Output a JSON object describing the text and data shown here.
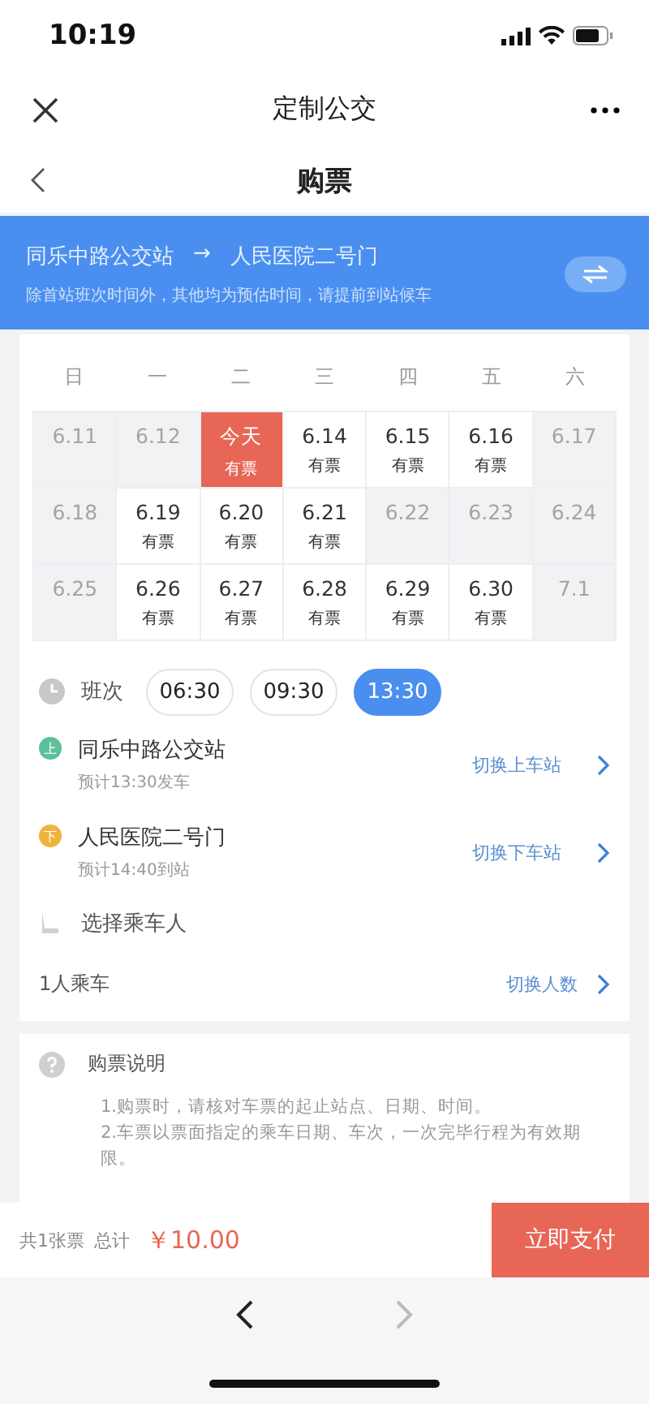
{
  "status_bar": {
    "time": "10:19"
  },
  "nav": {
    "title": "定制公交"
  },
  "header": {
    "title": "购票"
  },
  "route": {
    "from": "同乐中路公交站",
    "arrow": "→",
    "to": "人民医院二号门",
    "note": "除首站班次时间外，其他均为预估时间，请提前到站候车"
  },
  "calendar": {
    "weekdays": [
      "日",
      "一",
      "二",
      "三",
      "四",
      "五",
      "六"
    ],
    "weeks": [
      [
        {
          "date": "6.11",
          "available": false,
          "selected": false
        },
        {
          "date": "6.12",
          "available": false,
          "selected": false
        },
        {
          "date": "今天",
          "ticket": "有票",
          "available": true,
          "selected": true
        },
        {
          "date": "6.14",
          "ticket": "有票",
          "available": true,
          "selected": false
        },
        {
          "date": "6.15",
          "ticket": "有票",
          "available": true,
          "selected": false
        },
        {
          "date": "6.16",
          "ticket": "有票",
          "available": true,
          "selected": false
        },
        {
          "date": "6.17",
          "available": false,
          "selected": false
        }
      ],
      [
        {
          "date": "6.18",
          "available": false,
          "selected": false
        },
        {
          "date": "6.19",
          "ticket": "有票",
          "available": true,
          "selected": false
        },
        {
          "date": "6.20",
          "ticket": "有票",
          "available": true,
          "selected": false
        },
        {
          "date": "6.21",
          "ticket": "有票",
          "available": true,
          "selected": false
        },
        {
          "date": "6.22",
          "available": false,
          "selected": false
        },
        {
          "date": "6.23",
          "available": false,
          "selected": false
        },
        {
          "date": "6.24",
          "available": false,
          "selected": false
        }
      ],
      [
        {
          "date": "6.25",
          "available": false,
          "selected": false
        },
        {
          "date": "6.26",
          "ticket": "有票",
          "available": true,
          "selected": false
        },
        {
          "date": "6.27",
          "ticket": "有票",
          "available": true,
          "selected": false
        },
        {
          "date": "6.28",
          "ticket": "有票",
          "available": true,
          "selected": false
        },
        {
          "date": "6.29",
          "ticket": "有票",
          "available": true,
          "selected": false
        },
        {
          "date": "6.30",
          "ticket": "有票",
          "available": true,
          "selected": false
        },
        {
          "date": "7.1",
          "available": false,
          "selected": false
        }
      ]
    ]
  },
  "schedule": {
    "label": "班次",
    "times": [
      {
        "label": "06:30",
        "selected": false
      },
      {
        "label": "09:30",
        "selected": false
      },
      {
        "label": "13:30",
        "selected": true
      }
    ]
  },
  "stops": [
    {
      "badge": "上",
      "color": "#5cc19a",
      "name": "同乐中路公交站",
      "eta": "预计13:30发车",
      "action": "切换上车站"
    },
    {
      "badge": "下",
      "color": "#f0b43c",
      "name": "人民医院二号门",
      "eta": "预计14:40到站",
      "action": "切换下车站"
    }
  ],
  "passenger": {
    "label": "选择乘车人",
    "count": "1人乘车",
    "action": "切换人数"
  },
  "notes": {
    "title": "购票说明",
    "lines": [
      "1.购票时，请核对车票的起止站点、日期、时间。",
      "2.车票以票面指定的乘车日期、车次，一次完毕行程为有效期限。"
    ]
  },
  "footer": {
    "tickets": "共1张票",
    "total_label": "总计",
    "price": "￥10.00",
    "pay": "立即支付"
  }
}
